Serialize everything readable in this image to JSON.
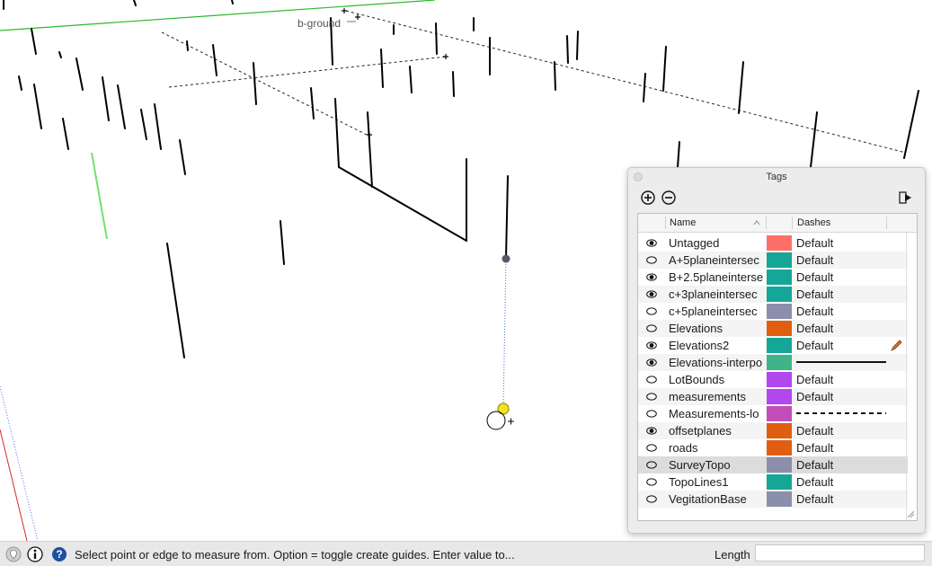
{
  "viewport": {
    "guide_label": "b-ground",
    "colors": {
      "green_axis": "#2db82d",
      "light_green": "#6fe36f",
      "red_axis": "#d42a2a",
      "blue_guide": "#4a6fd8",
      "cursor_yellow": "#f2e41a",
      "point": "#555a66"
    }
  },
  "tags_panel": {
    "title": "Tags",
    "toolbar": {
      "add_icon": "plus-circle-icon",
      "remove_icon": "minus-circle-icon",
      "details_icon": "details-arrow-icon"
    },
    "columns": {
      "name": "Name",
      "dashes": "Dashes"
    },
    "rows": [
      {
        "name": "Untagged",
        "visible": true,
        "color": "#ff6f6a",
        "dashes": "Default"
      },
      {
        "name": "A+5planeintersec",
        "visible": false,
        "color": "#16a697",
        "dashes": "Default"
      },
      {
        "name": "B+2.5planeinterse",
        "visible": true,
        "color": "#16a697",
        "dashes": "Default"
      },
      {
        "name": "c+3planeintersec",
        "visible": true,
        "color": "#16a697",
        "dashes": "Default"
      },
      {
        "name": "c+5planeintersec",
        "visible": false,
        "color": "#8c8fab",
        "dashes": "Default"
      },
      {
        "name": "Elevations",
        "visible": false,
        "color": "#e05e10",
        "dashes": "Default"
      },
      {
        "name": "Elevations2",
        "visible": true,
        "color": "#16a697",
        "dashes": "Default"
      },
      {
        "name": "Elevations-interpo",
        "visible": true,
        "color": "#3fb48a",
        "dashes": ""
      },
      {
        "name": "LotBounds",
        "visible": false,
        "color": "#b247f0",
        "dashes": "Default"
      },
      {
        "name": "measurements",
        "visible": false,
        "color": "#b247f0",
        "dashes": "Default"
      },
      {
        "name": "Measurements-lo",
        "visible": false,
        "color": "#c14db8",
        "dashes": ""
      },
      {
        "name": "offsetplanes",
        "visible": true,
        "color": "#e05e10",
        "dashes": "Default"
      },
      {
        "name": "roads",
        "visible": false,
        "color": "#e05e10",
        "dashes": "Default"
      },
      {
        "name": "SurveyTopo",
        "visible": false,
        "color": "#8c8fab",
        "dashes": "Default"
      },
      {
        "name": "TopoLines1",
        "visible": false,
        "color": "#16a697",
        "dashes": "Default"
      },
      {
        "name": "VegitationBase",
        "visible": false,
        "color": "#8c8fab",
        "dashes": "Default"
      }
    ]
  },
  "status_bar": {
    "text": "Select point or edge to measure from.  Option = toggle create guides.  Enter value to...",
    "length_label": "Length",
    "length_value": "",
    "icons": [
      "geo-location-icon",
      "credits-icon",
      "help-icon"
    ]
  }
}
